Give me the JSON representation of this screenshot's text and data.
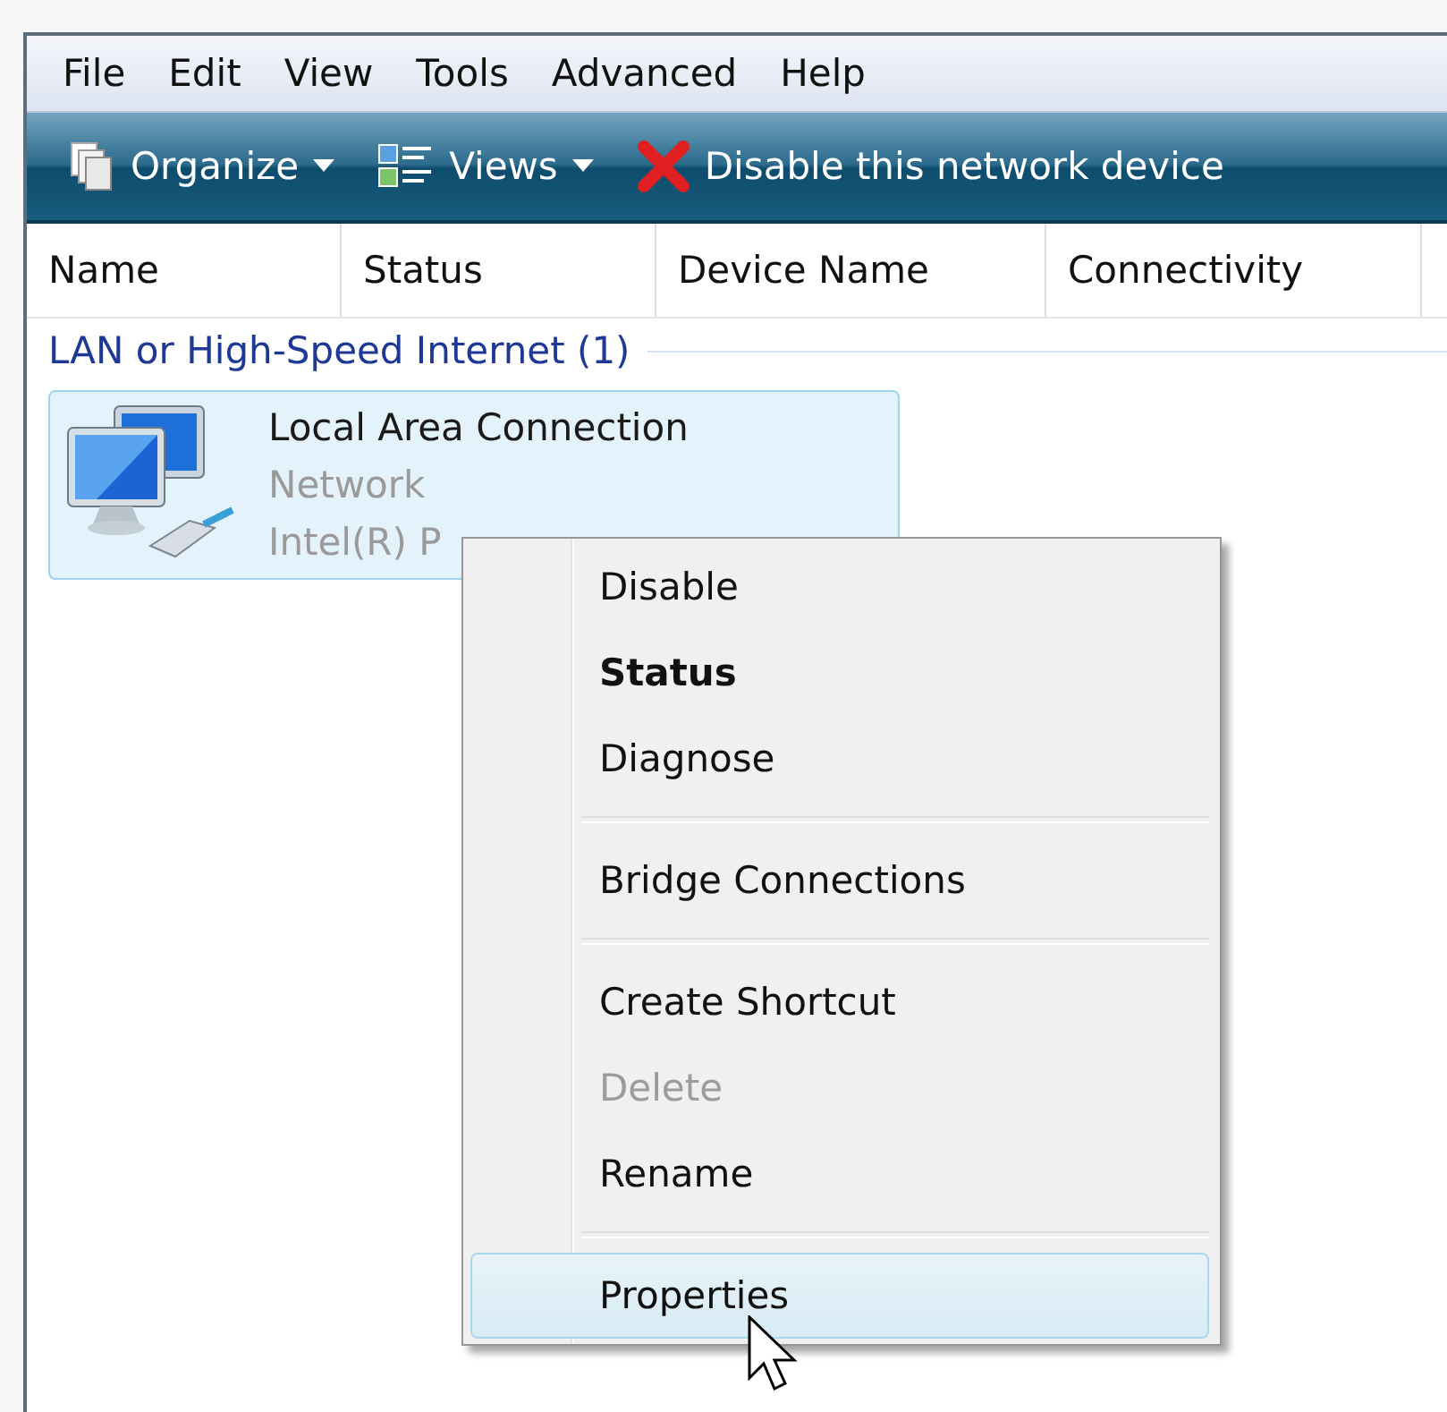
{
  "menu_bar": [
    "File",
    "Edit",
    "View",
    "Tools",
    "Advanced",
    "Help"
  ],
  "toolbar": [
    {
      "label": "Organize",
      "kind": "pages",
      "dropdown": true
    },
    {
      "label": "Views",
      "kind": "views",
      "dropdown": true
    },
    {
      "label": "Disable this network device",
      "kind": "disable",
      "dropdown": false
    }
  ],
  "columns": [
    "Name",
    "Status",
    "Device Name",
    "Connectivity"
  ],
  "group": {
    "title": "LAN or High-Speed Internet (1)"
  },
  "connection": {
    "name": "Local Area Connection",
    "type": "Network",
    "device": "Intel(R) P",
    "selected": true
  },
  "context_menu": [
    {
      "kind": "item",
      "label": "Disable",
      "default": false,
      "disabled": false,
      "selected": false
    },
    {
      "kind": "item",
      "label": "Status",
      "default": true,
      "disabled": false,
      "selected": false
    },
    {
      "kind": "item",
      "label": "Diagnose",
      "default": false,
      "disabled": false,
      "selected": false
    },
    {
      "kind": "separator"
    },
    {
      "kind": "item",
      "label": "Bridge Connections",
      "default": false,
      "disabled": false,
      "selected": false
    },
    {
      "kind": "separator"
    },
    {
      "kind": "item",
      "label": "Create Shortcut",
      "default": false,
      "disabled": false,
      "selected": false
    },
    {
      "kind": "item",
      "label": "Delete",
      "default": false,
      "disabled": true,
      "selected": false
    },
    {
      "kind": "item",
      "label": "Rename",
      "default": false,
      "disabled": false,
      "selected": false
    },
    {
      "kind": "separator"
    },
    {
      "kind": "item",
      "label": "Properties",
      "default": false,
      "disabled": false,
      "selected": true
    }
  ]
}
